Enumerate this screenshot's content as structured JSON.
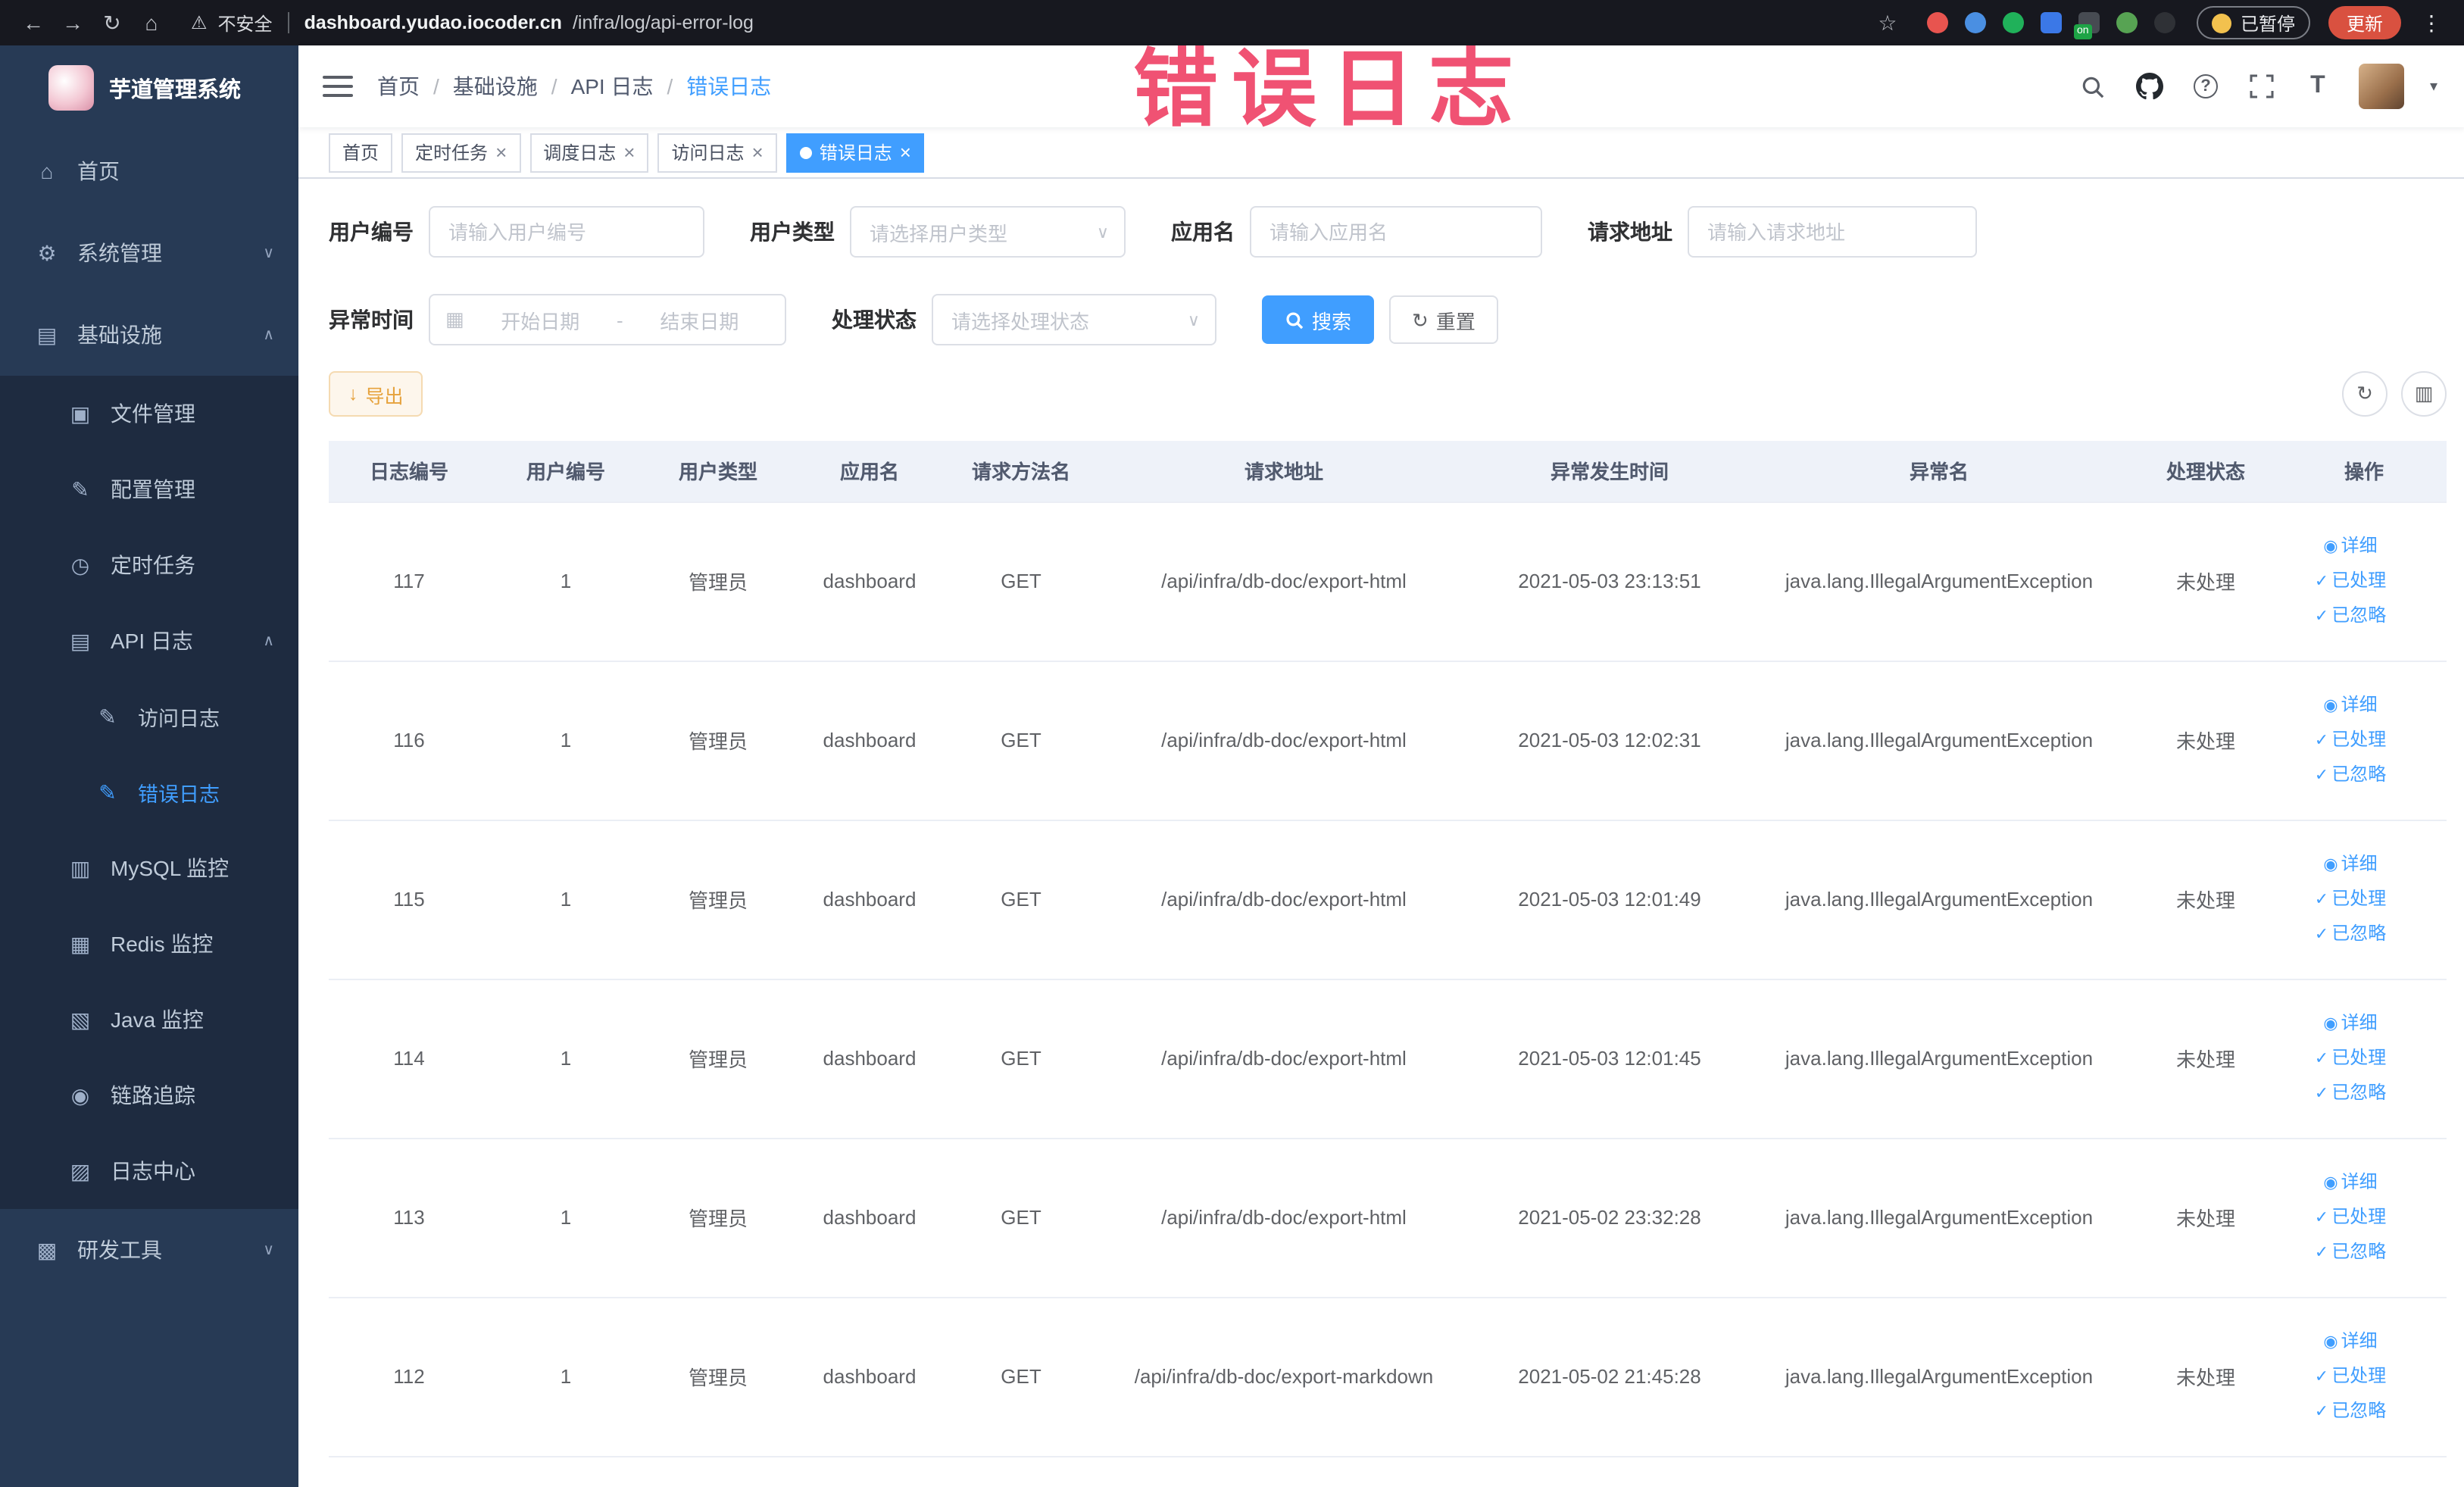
{
  "browser": {
    "security_warning": "不安全",
    "url_domain": "dashboard.yudao.iocoder.cn",
    "url_path": "/infra/log/api-error-log",
    "extension_on_badge": "on",
    "paused_badge": "已暂停",
    "update_button": "更新"
  },
  "overlay_title": "错误日志",
  "icons": {
    "back": "←",
    "forward": "→",
    "reload": "↻",
    "home": "⌂",
    "warning": "⚠",
    "star": "☆",
    "menu_dots": "⋮",
    "slash": "/",
    "caret_down": "▾",
    "chevron_down": "∨",
    "chevron_up": "∧",
    "calendar": "▦",
    "range_separator": "-",
    "refresh": "↻",
    "columns": "▥",
    "download": "↓",
    "eye": "◉",
    "check": "✓",
    "close": "×",
    "active_dot": "●",
    "font_size": "T",
    "question": "?"
  },
  "sidebar": {
    "logo_title": "芋道管理系统",
    "items": [
      {
        "label": "首页",
        "icon": "⌂"
      },
      {
        "label": "系统管理",
        "icon": "⚙"
      },
      {
        "label": "基础设施",
        "icon": "▤"
      },
      {
        "label": "文件管理",
        "icon": "▣"
      },
      {
        "label": "配置管理",
        "icon": "✎"
      },
      {
        "label": "定时任务",
        "icon": "◷"
      },
      {
        "label": "API 日志",
        "icon": "▤"
      },
      {
        "label": "访问日志",
        "icon": "✎"
      },
      {
        "label": "错误日志",
        "icon": "✎"
      },
      {
        "label": "MySQL 监控",
        "icon": "▥"
      },
      {
        "label": "Redis 监控",
        "icon": "▦"
      },
      {
        "label": "Java 监控",
        "icon": "▧"
      },
      {
        "label": "链路追踪",
        "icon": "◉"
      },
      {
        "label": "日志中心",
        "icon": "▨"
      },
      {
        "label": "研发工具",
        "icon": "▩"
      }
    ]
  },
  "header": {
    "breadcrumb": [
      "首页",
      "基础设施",
      "API 日志",
      "错误日志"
    ]
  },
  "tabs": [
    {
      "label": "首页"
    },
    {
      "label": "定时任务"
    },
    {
      "label": "调度日志"
    },
    {
      "label": "访问日志"
    },
    {
      "label": "错误日志"
    }
  ],
  "filters": {
    "user_id_label": "用户编号",
    "user_id_placeholder": "请输入用户编号",
    "user_type_label": "用户类型",
    "user_type_placeholder": "请选择用户类型",
    "app_name_label": "应用名",
    "app_name_placeholder": "请输入应用名",
    "request_url_label": "请求地址",
    "request_url_placeholder": "请输入请求地址",
    "exception_time_label": "异常时间",
    "start_date_placeholder": "开始日期",
    "end_date_placeholder": "结束日期",
    "process_status_label": "处理状态",
    "process_status_placeholder": "请选择处理状态",
    "search_button": "搜索",
    "reset_button": "重置"
  },
  "toolbar": {
    "export_button": "导出"
  },
  "table": {
    "columns": [
      "日志编号",
      "用户编号",
      "用户类型",
      "应用名",
      "请求方法名",
      "请求地址",
      "异常发生时间",
      "异常名",
      "处理状态",
      "操作"
    ],
    "action_labels": {
      "detail": "详细",
      "processed": "已处理",
      "ignore": "已忽略"
    },
    "rows": [
      {
        "id": "117",
        "user_id": "1",
        "user_type": "管理员",
        "app": "dashboard",
        "method": "GET",
        "url": "/api/infra/db-doc/export-html",
        "time": "2021-05-03 23:13:51",
        "exception": "java.lang.IllegalArgumentException",
        "status": "未处理"
      },
      {
        "id": "116",
        "user_id": "1",
        "user_type": "管理员",
        "app": "dashboard",
        "method": "GET",
        "url": "/api/infra/db-doc/export-html",
        "time": "2021-05-03 12:02:31",
        "exception": "java.lang.IllegalArgumentException",
        "status": "未处理"
      },
      {
        "id": "115",
        "user_id": "1",
        "user_type": "管理员",
        "app": "dashboard",
        "method": "GET",
        "url": "/api/infra/db-doc/export-html",
        "time": "2021-05-03 12:01:49",
        "exception": "java.lang.IllegalArgumentException",
        "status": "未处理"
      },
      {
        "id": "114",
        "user_id": "1",
        "user_type": "管理员",
        "app": "dashboard",
        "method": "GET",
        "url": "/api/infra/db-doc/export-html",
        "time": "2021-05-03 12:01:45",
        "exception": "java.lang.IllegalArgumentException",
        "status": "未处理"
      },
      {
        "id": "113",
        "user_id": "1",
        "user_type": "管理员",
        "app": "dashboard",
        "method": "GET",
        "url": "/api/infra/db-doc/export-html",
        "time": "2021-05-02 23:32:28",
        "exception": "java.lang.IllegalArgumentException",
        "status": "未处理"
      },
      {
        "id": "112",
        "user_id": "1",
        "user_type": "管理员",
        "app": "dashboard",
        "method": "GET",
        "url": "/api/infra/db-doc/export-markdown",
        "time": "2021-05-02 21:45:28",
        "exception": "java.lang.IllegalArgumentException",
        "status": "未处理"
      }
    ]
  }
}
